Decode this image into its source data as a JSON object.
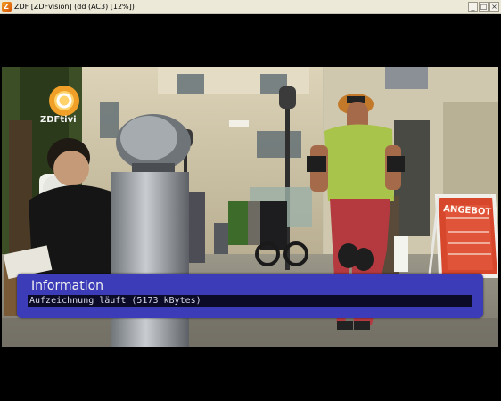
{
  "window": {
    "title": "ZDF [ZDFvision] (dd (AC3) [12%])",
    "minimize_glyph": "_",
    "maximize_glyph": "□",
    "close_glyph": "×"
  },
  "channel_logo": {
    "text": "ZDFtivi"
  },
  "video": {
    "shop_sign": "ANGEBOT"
  },
  "info_panel": {
    "title": "Information",
    "message": "Aufzeichnung läuft (5173 kBytes)"
  },
  "colors": {
    "panel_bg": "#3c3cb8",
    "message_bg": "#0b0b28",
    "letterbox": "#000000"
  }
}
